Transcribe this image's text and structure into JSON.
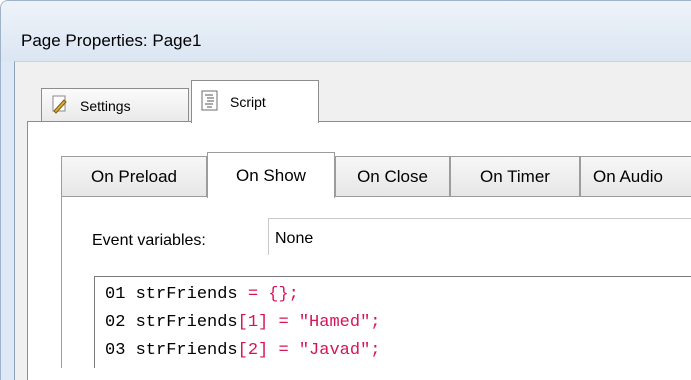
{
  "window": {
    "title": "Page Properties: Page1"
  },
  "outer_tabs": [
    {
      "label": "Settings",
      "icon": "settings-icon",
      "active": false
    },
    {
      "label": "Script",
      "icon": "script-icon",
      "active": true
    }
  ],
  "inner_tabs": [
    {
      "label": "On Preload",
      "active": false
    },
    {
      "label": "On Show",
      "active": true
    },
    {
      "label": "On Close",
      "active": false
    },
    {
      "label": "On Timer",
      "active": false
    },
    {
      "label": "On Audio",
      "active": false
    }
  ],
  "event_variables": {
    "label": "Event variables:",
    "value": "None"
  },
  "code_lines": [
    {
      "num": "01",
      "text": "strFriends",
      "op": "=",
      "rest": "{};"
    },
    {
      "num": "02",
      "text": "strFriends",
      "idx": "[1]",
      "op": "=",
      "rest": "\"Hamed\";"
    },
    {
      "num": "03",
      "text": "strFriends",
      "idx": "[2]",
      "op": "=",
      "rest": "\"Javad\";"
    }
  ],
  "colors": {
    "accent": "#d4145a",
    "window_frame": "#dfe9f5"
  }
}
